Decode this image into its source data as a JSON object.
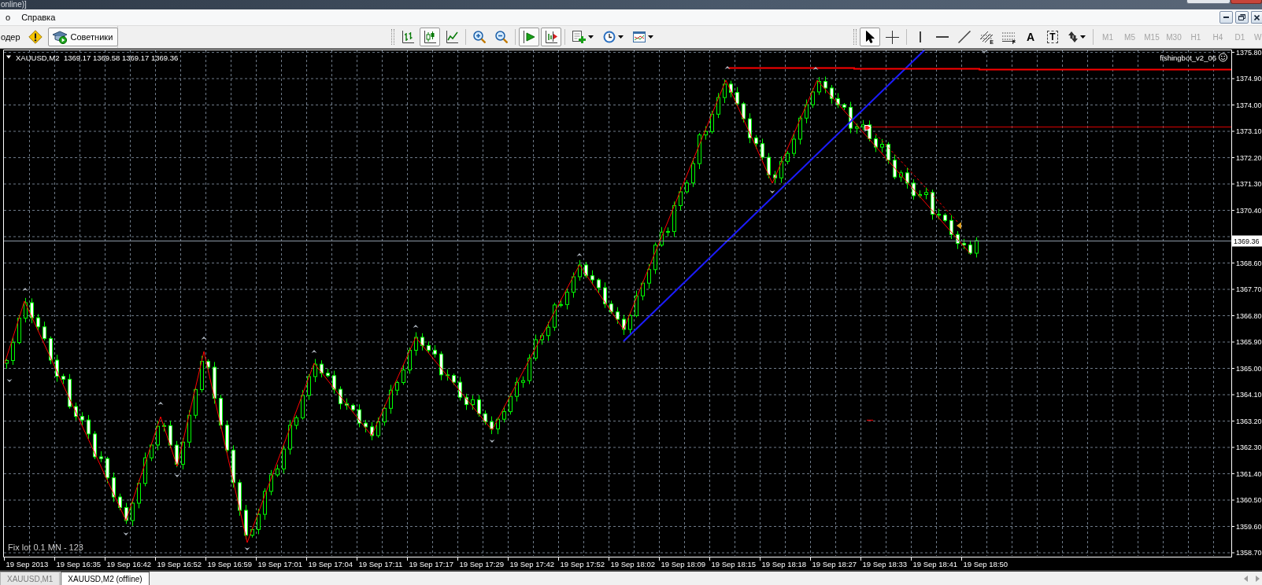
{
  "window": {
    "title_fragment": "online)]"
  },
  "menu": [
    "о",
    "Справка"
  ],
  "toolbar": {
    "fragment": "одер",
    "experts": {
      "label": "Советники",
      "pressed": true
    },
    "chart_tool_groups": [
      [
        {
          "kind": "bars",
          "pressed": false
        },
        {
          "kind": "candles",
          "pressed": true
        },
        {
          "kind": "line",
          "pressed": false
        }
      ],
      [
        {
          "kind": "zoomin",
          "pressed": false
        },
        {
          "kind": "zoomout",
          "pressed": false
        }
      ],
      [
        {
          "kind": "autoscroll",
          "pressed": true
        },
        {
          "kind": "shift",
          "pressed": true
        }
      ],
      [
        {
          "kind": "indicators",
          "pressed": false
        },
        {
          "kind": "periods",
          "pressed": false
        },
        {
          "kind": "templates",
          "pressed": false
        }
      ]
    ],
    "drawing_tool_groups": [
      [
        {
          "kind": "cursor",
          "pressed": true
        },
        {
          "kind": "crosshair",
          "pressed": false
        }
      ],
      [
        {
          "kind": "vline",
          "pressed": false
        },
        {
          "kind": "hline",
          "pressed": false
        },
        {
          "kind": "trendline",
          "pressed": false
        },
        {
          "kind": "fibochannel",
          "badge": "E",
          "pressed": false
        },
        {
          "kind": "fibo",
          "badge": "F",
          "pressed": false
        },
        {
          "kind": "text",
          "glyph": "A",
          "pressed": false
        },
        {
          "kind": "label",
          "glyph": "T",
          "pressed": false
        },
        {
          "kind": "arrows",
          "pressed": false
        }
      ]
    ],
    "timeframes": [
      {
        "label": "M1",
        "disabled": true
      },
      {
        "label": "M5",
        "disabled": true
      },
      {
        "label": "M15",
        "disabled": true
      },
      {
        "label": "M30",
        "disabled": true
      },
      {
        "label": "H1",
        "disabled": true
      },
      {
        "label": "H4",
        "disabled": true
      },
      {
        "label": "D1",
        "disabled": true
      },
      {
        "label": "W",
        "disabled": true
      }
    ]
  },
  "chart": {
    "symbol": "XAUUSD,M2",
    "ohlc": "1369.17 1369.58 1369.17 1369.36",
    "expert": "fishingbot_v2_06",
    "comment": "Fix lot 0.1 MN - 123",
    "price_labels_upper": [
      "1375.80",
      "1374.90",
      "1374.00",
      "1373.10",
      "1372.20",
      "1371.30",
      "1370.40"
    ],
    "current_price": "1369.36",
    "price_labels_lower": [
      "1368.60",
      "1367.70",
      "1366.80",
      "1365.90",
      "1365.00",
      "1364.10",
      "1363.20",
      "1362.30",
      "1361.40",
      "1360.50",
      "1359.60",
      "1358.70"
    ],
    "time_labels": [
      "19 Sep 2013",
      "19 Sep 16:35",
      "19 Sep 16:42",
      "19 Sep 16:52",
      "19 Sep 16:59",
      "19 Sep 17:01",
      "19 Sep 17:04",
      "19 Sep 17:11",
      "19 Sep 17:17",
      "19 Sep 17:29",
      "19 Sep 17:42",
      "19 Sep 17:52",
      "19 Sep 18:02",
      "19 Sep 18:09",
      "19 Sep 18:15",
      "19 Sep 18:18",
      "19 Sep 18:27",
      "19 Sep 18:33",
      "19 Sep 18:41",
      "19 Sep 18:50"
    ]
  },
  "tabs": [
    {
      "label": "XAUUSD,M1",
      "selected": false
    },
    {
      "label": "XAUUSD,M2 (offline)",
      "selected": true
    }
  ]
}
